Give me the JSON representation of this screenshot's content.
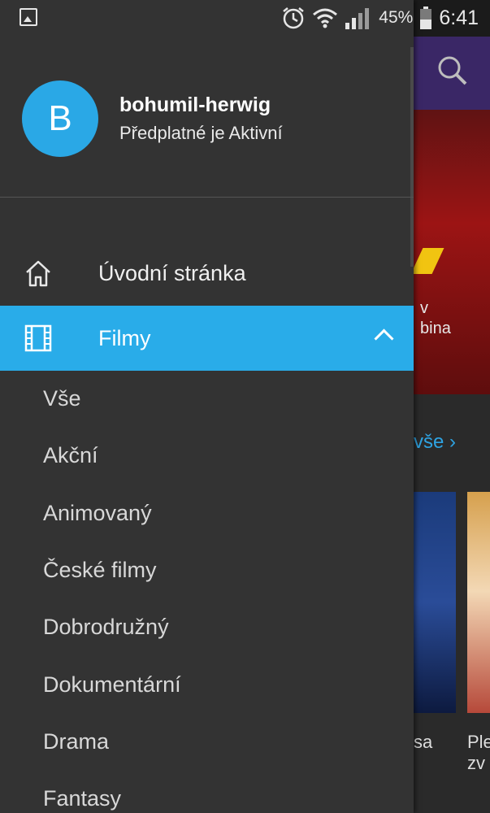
{
  "status_bar": {
    "battery_percent": "45%",
    "time": "6:41"
  },
  "drawer": {
    "avatar_letter": "B",
    "username": "bohumil-herwig",
    "subscription": "Předplatné je Aktivní",
    "nav": {
      "home": "Úvodní stránka",
      "films": "Filmy"
    },
    "film_categories": [
      "Vše",
      "Akční",
      "Animovaný",
      "České filmy",
      "Dobrodružný",
      "Dokumentární",
      "Drama",
      "Fantasy"
    ]
  },
  "background": {
    "banner_line1": "v",
    "banner_line2": "bina",
    "see_all": "vše ›",
    "tile1_title": "sa",
    "tile2_title_line1": "Ple",
    "tile2_title_line2": "zv"
  },
  "colors": {
    "accent": "#29ace9",
    "drawer_bg": "#333333"
  }
}
